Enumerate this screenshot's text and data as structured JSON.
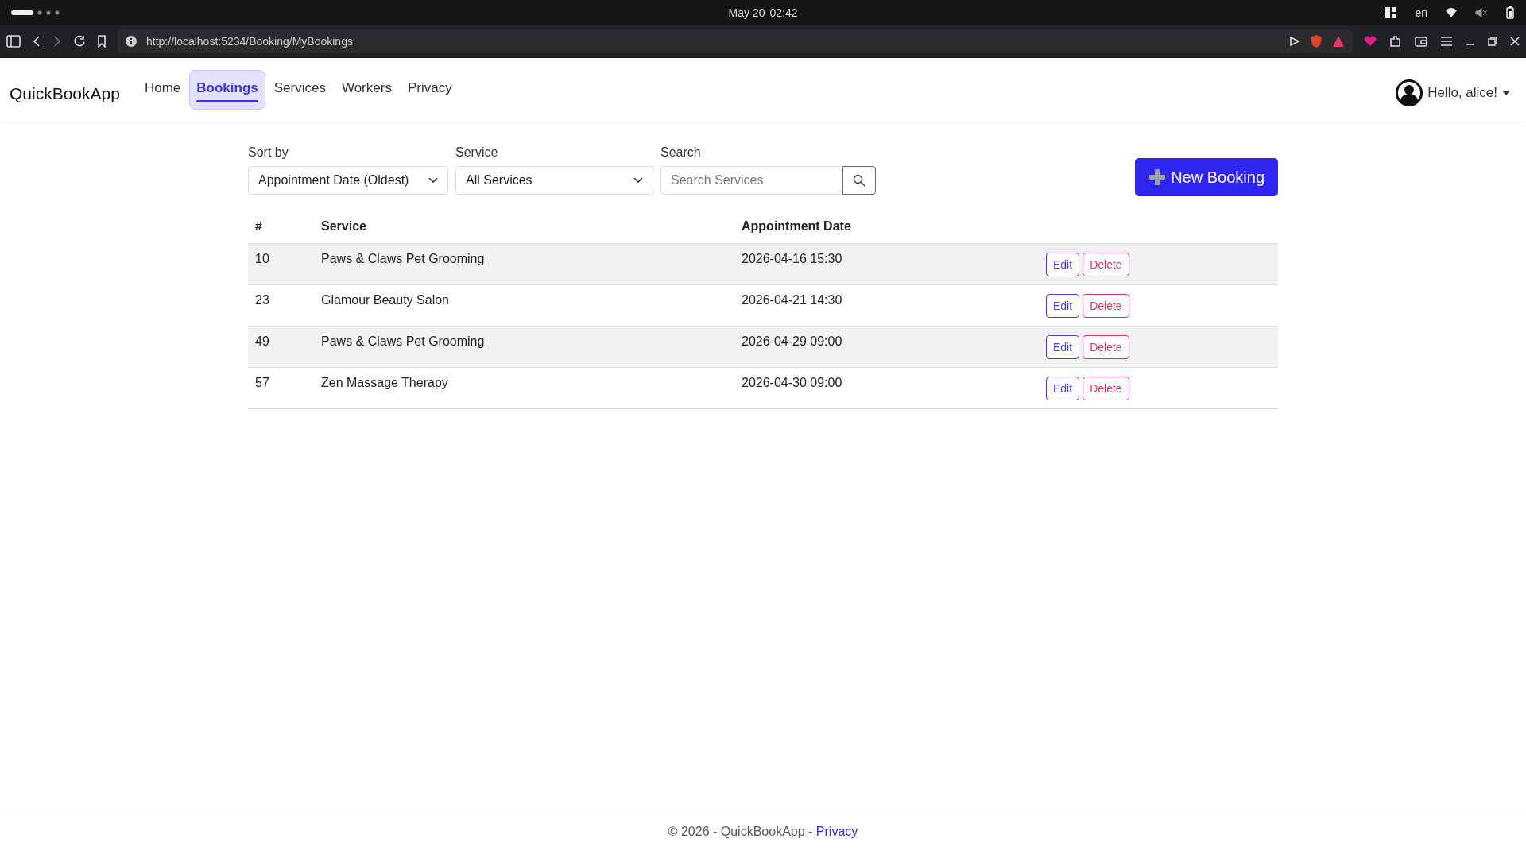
{
  "system_bar": {
    "date": "May 20",
    "time": "02:42",
    "language": "en"
  },
  "browser": {
    "url": "http://localhost:5234/Booking/MyBookings"
  },
  "navbar": {
    "brand": "QuickBookApp",
    "links": [
      {
        "label": "Home",
        "selected": false
      },
      {
        "label": "Bookings",
        "selected": true
      },
      {
        "label": "Services",
        "selected": false
      },
      {
        "label": "Workers",
        "selected": false
      },
      {
        "label": "Privacy",
        "selected": false
      }
    ],
    "user": "Hello, alice!"
  },
  "filters": {
    "sort": {
      "label": "Sort by",
      "value": "Appointment Date (Oldest)"
    },
    "service": {
      "label": "Service",
      "value": "All Services"
    },
    "search": {
      "label": "Search",
      "placeholder": "Search Services"
    },
    "new_button": "New Booking"
  },
  "table": {
    "columns": [
      "#",
      "Service",
      "Appointment Date"
    ],
    "rows": [
      {
        "id": "10",
        "service": "Paws & Claws Pet Grooming",
        "date": "2026-04-16 15:30",
        "actions": [
          {
            "label": "Edit",
            "kind": "edit"
          },
          {
            "label": "Delete",
            "kind": "delete"
          }
        ]
      },
      {
        "id": "23",
        "service": "Glamour Beauty Salon",
        "date": "2026-04-21 14:30",
        "actions": [
          {
            "label": "Edit",
            "kind": "edit"
          },
          {
            "label": "Delete",
            "kind": "delete"
          }
        ]
      },
      {
        "id": "49",
        "service": "Paws & Claws Pet Grooming",
        "date": "2026-04-29 09:00",
        "actions": [
          {
            "label": "Edit",
            "kind": "edit"
          },
          {
            "label": "Delete",
            "kind": "delete"
          }
        ]
      },
      {
        "id": "57",
        "service": "Zen Massage Therapy",
        "date": "2026-04-30 09:00",
        "actions": [
          {
            "label": "Edit",
            "kind": "edit"
          },
          {
            "label": "Delete",
            "kind": "delete"
          }
        ]
      }
    ]
  },
  "footer": {
    "text": "© 2026 - QuickBookApp - ",
    "link": "Privacy"
  }
}
